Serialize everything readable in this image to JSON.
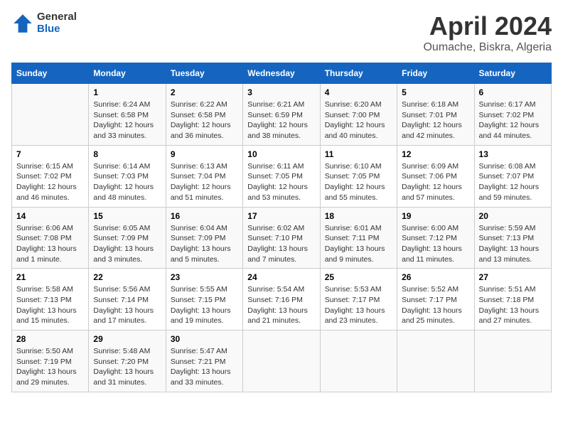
{
  "logo": {
    "general": "General",
    "blue": "Blue"
  },
  "title": "April 2024",
  "location": "Oumache, Biskra, Algeria",
  "days_header": [
    "Sunday",
    "Monday",
    "Tuesday",
    "Wednesday",
    "Thursday",
    "Friday",
    "Saturday"
  ],
  "weeks": [
    [
      {
        "num": "",
        "sunrise": "",
        "sunset": "",
        "daylight": ""
      },
      {
        "num": "1",
        "sunrise": "Sunrise: 6:24 AM",
        "sunset": "Sunset: 6:58 PM",
        "daylight": "Daylight: 12 hours and 33 minutes."
      },
      {
        "num": "2",
        "sunrise": "Sunrise: 6:22 AM",
        "sunset": "Sunset: 6:58 PM",
        "daylight": "Daylight: 12 hours and 36 minutes."
      },
      {
        "num": "3",
        "sunrise": "Sunrise: 6:21 AM",
        "sunset": "Sunset: 6:59 PM",
        "daylight": "Daylight: 12 hours and 38 minutes."
      },
      {
        "num": "4",
        "sunrise": "Sunrise: 6:20 AM",
        "sunset": "Sunset: 7:00 PM",
        "daylight": "Daylight: 12 hours and 40 minutes."
      },
      {
        "num": "5",
        "sunrise": "Sunrise: 6:18 AM",
        "sunset": "Sunset: 7:01 PM",
        "daylight": "Daylight: 12 hours and 42 minutes."
      },
      {
        "num": "6",
        "sunrise": "Sunrise: 6:17 AM",
        "sunset": "Sunset: 7:02 PM",
        "daylight": "Daylight: 12 hours and 44 minutes."
      }
    ],
    [
      {
        "num": "7",
        "sunrise": "Sunrise: 6:15 AM",
        "sunset": "Sunset: 7:02 PM",
        "daylight": "Daylight: 12 hours and 46 minutes."
      },
      {
        "num": "8",
        "sunrise": "Sunrise: 6:14 AM",
        "sunset": "Sunset: 7:03 PM",
        "daylight": "Daylight: 12 hours and 48 minutes."
      },
      {
        "num": "9",
        "sunrise": "Sunrise: 6:13 AM",
        "sunset": "Sunset: 7:04 PM",
        "daylight": "Daylight: 12 hours and 51 minutes."
      },
      {
        "num": "10",
        "sunrise": "Sunrise: 6:11 AM",
        "sunset": "Sunset: 7:05 PM",
        "daylight": "Daylight: 12 hours and 53 minutes."
      },
      {
        "num": "11",
        "sunrise": "Sunrise: 6:10 AM",
        "sunset": "Sunset: 7:05 PM",
        "daylight": "Daylight: 12 hours and 55 minutes."
      },
      {
        "num": "12",
        "sunrise": "Sunrise: 6:09 AM",
        "sunset": "Sunset: 7:06 PM",
        "daylight": "Daylight: 12 hours and 57 minutes."
      },
      {
        "num": "13",
        "sunrise": "Sunrise: 6:08 AM",
        "sunset": "Sunset: 7:07 PM",
        "daylight": "Daylight: 12 hours and 59 minutes."
      }
    ],
    [
      {
        "num": "14",
        "sunrise": "Sunrise: 6:06 AM",
        "sunset": "Sunset: 7:08 PM",
        "daylight": "Daylight: 13 hours and 1 minute."
      },
      {
        "num": "15",
        "sunrise": "Sunrise: 6:05 AM",
        "sunset": "Sunset: 7:09 PM",
        "daylight": "Daylight: 13 hours and 3 minutes."
      },
      {
        "num": "16",
        "sunrise": "Sunrise: 6:04 AM",
        "sunset": "Sunset: 7:09 PM",
        "daylight": "Daylight: 13 hours and 5 minutes."
      },
      {
        "num": "17",
        "sunrise": "Sunrise: 6:02 AM",
        "sunset": "Sunset: 7:10 PM",
        "daylight": "Daylight: 13 hours and 7 minutes."
      },
      {
        "num": "18",
        "sunrise": "Sunrise: 6:01 AM",
        "sunset": "Sunset: 7:11 PM",
        "daylight": "Daylight: 13 hours and 9 minutes."
      },
      {
        "num": "19",
        "sunrise": "Sunrise: 6:00 AM",
        "sunset": "Sunset: 7:12 PM",
        "daylight": "Daylight: 13 hours and 11 minutes."
      },
      {
        "num": "20",
        "sunrise": "Sunrise: 5:59 AM",
        "sunset": "Sunset: 7:13 PM",
        "daylight": "Daylight: 13 hours and 13 minutes."
      }
    ],
    [
      {
        "num": "21",
        "sunrise": "Sunrise: 5:58 AM",
        "sunset": "Sunset: 7:13 PM",
        "daylight": "Daylight: 13 hours and 15 minutes."
      },
      {
        "num": "22",
        "sunrise": "Sunrise: 5:56 AM",
        "sunset": "Sunset: 7:14 PM",
        "daylight": "Daylight: 13 hours and 17 minutes."
      },
      {
        "num": "23",
        "sunrise": "Sunrise: 5:55 AM",
        "sunset": "Sunset: 7:15 PM",
        "daylight": "Daylight: 13 hours and 19 minutes."
      },
      {
        "num": "24",
        "sunrise": "Sunrise: 5:54 AM",
        "sunset": "Sunset: 7:16 PM",
        "daylight": "Daylight: 13 hours and 21 minutes."
      },
      {
        "num": "25",
        "sunrise": "Sunrise: 5:53 AM",
        "sunset": "Sunset: 7:17 PM",
        "daylight": "Daylight: 13 hours and 23 minutes."
      },
      {
        "num": "26",
        "sunrise": "Sunrise: 5:52 AM",
        "sunset": "Sunset: 7:17 PM",
        "daylight": "Daylight: 13 hours and 25 minutes."
      },
      {
        "num": "27",
        "sunrise": "Sunrise: 5:51 AM",
        "sunset": "Sunset: 7:18 PM",
        "daylight": "Daylight: 13 hours and 27 minutes."
      }
    ],
    [
      {
        "num": "28",
        "sunrise": "Sunrise: 5:50 AM",
        "sunset": "Sunset: 7:19 PM",
        "daylight": "Daylight: 13 hours and 29 minutes."
      },
      {
        "num": "29",
        "sunrise": "Sunrise: 5:48 AM",
        "sunset": "Sunset: 7:20 PM",
        "daylight": "Daylight: 13 hours and 31 minutes."
      },
      {
        "num": "30",
        "sunrise": "Sunrise: 5:47 AM",
        "sunset": "Sunset: 7:21 PM",
        "daylight": "Daylight: 13 hours and 33 minutes."
      },
      {
        "num": "",
        "sunrise": "",
        "sunset": "",
        "daylight": ""
      },
      {
        "num": "",
        "sunrise": "",
        "sunset": "",
        "daylight": ""
      },
      {
        "num": "",
        "sunrise": "",
        "sunset": "",
        "daylight": ""
      },
      {
        "num": "",
        "sunrise": "",
        "sunset": "",
        "daylight": ""
      }
    ]
  ]
}
